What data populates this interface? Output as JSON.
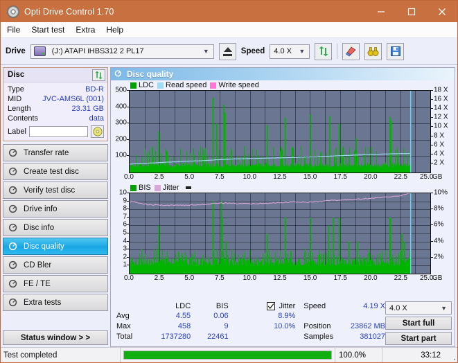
{
  "window": {
    "title": "Opti Drive Control 1.70",
    "icon": "disc-icon",
    "minimize": "minimize-icon",
    "maximize": "maximize-icon",
    "close": "close-icon"
  },
  "menu": {
    "items": [
      "File",
      "Start test",
      "Extra",
      "Help"
    ]
  },
  "toolbar": {
    "drive_label": "Drive",
    "drive_value": "(J:)   ATAPI iHBS312  2 PL17",
    "eject": "eject-icon",
    "speed_label": "Speed",
    "speed_value": "4.0 X",
    "refresh": "refresh-icon",
    "erase": "eraser-icon",
    "scan": "binoculars-icon",
    "save": "save-icon"
  },
  "disc": {
    "header": "Disc",
    "refresh": "refresh-icon",
    "rows": [
      {
        "key": "Type",
        "value": "BD-R"
      },
      {
        "key": "MID",
        "value": "JVC-AMS6L (001)"
      },
      {
        "key": "Length",
        "value": "23.31 GB"
      },
      {
        "key": "Contents",
        "value": "data"
      }
    ],
    "label_key": "Label",
    "label_value": "",
    "label_placeholder": "",
    "label_button": "disc-label-icon"
  },
  "sidebar": {
    "items": [
      {
        "label": "Transfer rate",
        "active": false
      },
      {
        "label": "Create test disc",
        "active": false
      },
      {
        "label": "Verify test disc",
        "active": false
      },
      {
        "label": "Drive info",
        "active": false
      },
      {
        "label": "Disc info",
        "active": false
      },
      {
        "label": "Disc quality",
        "active": true
      },
      {
        "label": "CD Bler",
        "active": false
      },
      {
        "label": "FE / TE",
        "active": false
      },
      {
        "label": "Extra tests",
        "active": false
      }
    ],
    "status_window": "Status window > >"
  },
  "panel": {
    "title": "Disc quality",
    "icon": "disc-quality-icon"
  },
  "chart_data": [
    {
      "type": "bar",
      "id": "ldc-chart",
      "title": "LDC / Read speed / Write speed",
      "legend": [
        {
          "name": "LDC",
          "color": "#00a000"
        },
        {
          "name": "Read speed",
          "color": "#9fdcf4"
        },
        {
          "name": "Write speed",
          "color": "#ff77d4"
        }
      ],
      "legend_position": "top-left",
      "xlabel": "GB",
      "x_ticks": [
        "0.0",
        "2.5",
        "5.0",
        "7.5",
        "10.0",
        "12.5",
        "15.0",
        "17.5",
        "20.0",
        "22.5",
        "25.0"
      ],
      "xlim": [
        0,
        25
      ],
      "ylabel": "LDC",
      "y_ticks": [
        100,
        200,
        300,
        400,
        500
      ],
      "ylim": [
        0,
        500
      ],
      "y2label": "Speed",
      "y2_ticks": [
        "2 X",
        "4 X",
        "6 X",
        "8 X",
        "10 X",
        "12 X",
        "14 X",
        "16 X",
        "18 X"
      ],
      "y2lim": [
        0,
        18
      ],
      "grid": true,
      "plot_bg": "#6b7693",
      "data_end_gb": 23.31,
      "ldc_baseline": 60,
      "ldc_typical_peak": 155,
      "ldc_spikes": [
        {
          "x": 2.4,
          "y": 248
        },
        {
          "x": 6.9,
          "y": 458
        },
        {
          "x": 7.2,
          "y": 300
        },
        {
          "x": 7.8,
          "y": 415
        },
        {
          "x": 7.9,
          "y": 365
        },
        {
          "x": 11.4,
          "y": 290
        },
        {
          "x": 12.9,
          "y": 335
        },
        {
          "x": 15.0,
          "y": 355
        },
        {
          "x": 16.6,
          "y": 345
        },
        {
          "x": 17.4,
          "y": 300
        },
        {
          "x": 18.8,
          "y": 210
        },
        {
          "x": 21.6,
          "y": 340
        },
        {
          "x": 21.7,
          "y": 318
        }
      ],
      "read_speed_series": {
        "name": "Read speed",
        "color": "#9fdcf4",
        "x": [
          0.0,
          1.5,
          3.0,
          4.5,
          6.0,
          7.5,
          9.0,
          10.5,
          12.0,
          13.5,
          15.0,
          16.5,
          18.0,
          19.5,
          21.0,
          22.5,
          23.3
        ],
        "values_x": [
          1.85,
          2.05,
          2.25,
          2.45,
          2.6,
          2.85,
          3.0,
          3.1,
          3.2,
          3.3,
          3.45,
          3.6,
          3.75,
          3.9,
          4.05,
          4.15,
          4.19
        ]
      },
      "write_speed_series": {
        "name": "Write speed",
        "color": "#ff77d4",
        "values": []
      },
      "end_marker_x": 23.35,
      "end_marker_color": "#5fd8f4"
    },
    {
      "type": "bar",
      "id": "bis-chart",
      "title": "BIS / Jitter",
      "legend": [
        {
          "name": "BIS",
          "color": "#00a000"
        },
        {
          "name": "Jitter",
          "color": "#d9a8d9"
        }
      ],
      "legend_position": "top-left",
      "xlabel": "GB",
      "x_ticks": [
        "0.0",
        "2.5",
        "5.0",
        "7.5",
        "10.0",
        "12.5",
        "15.0",
        "17.5",
        "20.0",
        "22.5",
        "25.0"
      ],
      "xlim": [
        0,
        25
      ],
      "ylabel": "BIS",
      "y_ticks": [
        1,
        2,
        3,
        4,
        5,
        6,
        7,
        8,
        9,
        10
      ],
      "ylim": [
        0,
        10
      ],
      "y2label": "Jitter",
      "y2_ticks": [
        "2%",
        "4%",
        "6%",
        "8%",
        "10%"
      ],
      "y2lim": [
        0,
        10
      ],
      "grid": true,
      "plot_bg": "#6b7693",
      "data_end_gb": 23.31,
      "bis_baseline": 2,
      "bis_typical_peak": 3,
      "bis_spikes": [
        {
          "x": 2.4,
          "y": 6
        },
        {
          "x": 6.9,
          "y": 9
        },
        {
          "x": 7.6,
          "y": 9
        },
        {
          "x": 7.65,
          "y": 7
        },
        {
          "x": 8.0,
          "y": 4
        },
        {
          "x": 11.4,
          "y": 5
        },
        {
          "x": 12.9,
          "y": 7
        },
        {
          "x": 15.0,
          "y": 7
        },
        {
          "x": 16.5,
          "y": 6
        },
        {
          "x": 16.9,
          "y": 7
        },
        {
          "x": 17.4,
          "y": 7
        },
        {
          "x": 18.2,
          "y": 4
        },
        {
          "x": 18.9,
          "y": 4
        },
        {
          "x": 21.6,
          "y": 7
        },
        {
          "x": 21.65,
          "y": 7
        },
        {
          "x": 22.6,
          "y": 5
        },
        {
          "x": 22.8,
          "y": 4
        }
      ],
      "jitter_series": {
        "name": "Jitter",
        "color": "#d9a8d9",
        "x": [
          0.0,
          1.5,
          3.0,
          4.5,
          6.0,
          7.5,
          9.0,
          10.5,
          12.0,
          13.5,
          15.0,
          16.5,
          18.0,
          19.5,
          21.0,
          22.5,
          23.3
        ],
        "values_pct": [
          9.0,
          8.6,
          8.5,
          8.5,
          8.6,
          8.8,
          8.7,
          8.7,
          8.8,
          8.9,
          8.9,
          9.1,
          9.2,
          9.3,
          9.5,
          9.7,
          10.0
        ]
      },
      "end_marker_x": 23.35,
      "end_marker_color": "#5fd8f4"
    }
  ],
  "stats": {
    "columns": [
      "LDC",
      "BIS"
    ],
    "jitter_label": "Jitter",
    "jitter_checked": true,
    "row_labels": [
      "Avg",
      "Max",
      "Total"
    ],
    "ldc": {
      "avg": "4.55",
      "max": "458",
      "total": "1737280"
    },
    "bis": {
      "avg": "0.06",
      "max": "9",
      "total": "22461"
    },
    "jitter": {
      "avg": "8.9%",
      "max": "10.0%"
    },
    "speed_label": "Speed",
    "speed_value": "4.19 X",
    "position_label": "Position",
    "position_value": "23862 MB",
    "samples_label": "Samples",
    "samples_value": "381027"
  },
  "controls": {
    "speed_value": "4.0 X",
    "start_full": "Start full",
    "start_part": "Start part"
  },
  "statusbar": {
    "text": "Test completed",
    "progress": 100,
    "percent": "100.0%",
    "time": "33:12"
  },
  "colors": {
    "title_bar": "#c8703f",
    "accent_blue": "#2a3fc0",
    "green": "#00a000",
    "plot_bg": "#6b7693",
    "active_nav": "#19a6e4"
  }
}
